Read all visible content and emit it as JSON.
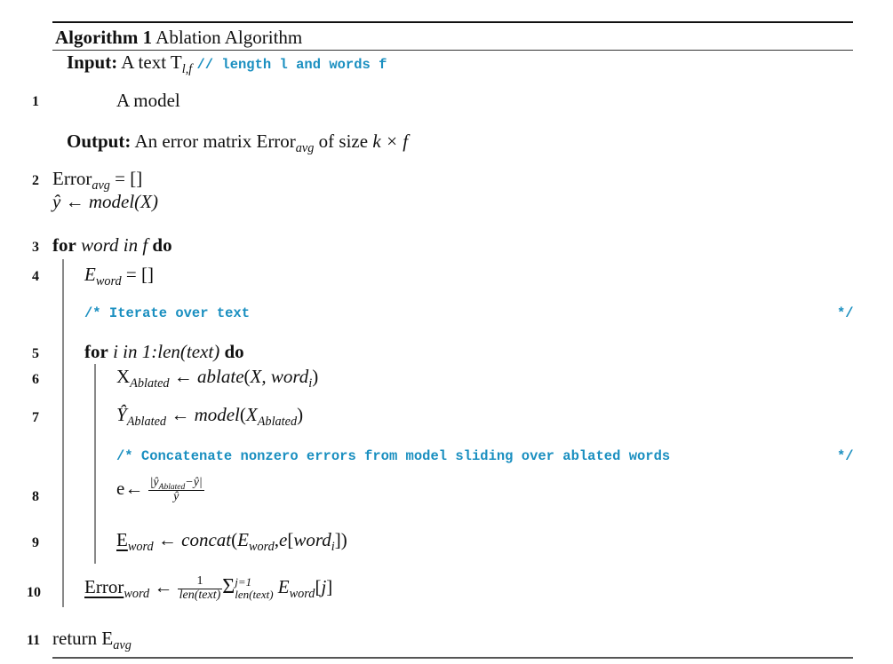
{
  "algorithm": {
    "caption_label": "Algorithm 1",
    "caption_title": "Ablation Algorithm",
    "input": {
      "label": "Input:",
      "text": "A text T",
      "text_sub": "l,f",
      "comment": "// length l and words f",
      "continuation": "A model"
    },
    "output": {
      "label": "Output:",
      "text_pre": "An error matrix Error",
      "text_sub": "avg",
      "text_post": " of size ",
      "size_expr": "k × f"
    },
    "lines": [
      {
        "number": "1",
        "text": "A model"
      },
      {
        "number": "2",
        "text": "Error_avg = []",
        "text2": "ŷ ← model(X)"
      },
      {
        "number": "3",
        "text": "for word in f do"
      },
      {
        "number": "4",
        "text": "E_word = []"
      },
      {
        "comment": "/* Iterate over text",
        "comment_end": "*/"
      },
      {
        "number": "5",
        "text": "for i in 1:len(text) do"
      },
      {
        "number": "6",
        "text": "X_Ablated ← ablate(X, word_i)"
      },
      {
        "number": "7",
        "text": "Ŷ_Ablated ← model(X_Ablated)"
      },
      {
        "comment": "/* Concatenate nonzero errors from model sliding over ablated words",
        "comment_end": "*/"
      },
      {
        "number": "8",
        "text": "e ← |ŷ_Ablated − ŷ| / ŷ"
      },
      {
        "number": "9",
        "text": "E_word ← concat(E_word, e[word_i])"
      },
      {
        "number": "10",
        "text": "Error_word ← 1/len(text) Σ_{len(text)}^{j=1} E_word[j]"
      },
      {
        "number": "11",
        "text": "return E_avg"
      }
    ],
    "tokens": {
      "error": "Error",
      "avg": "avg",
      "empty_list": "[]",
      "eq": " = ",
      "arrow": " ← ",
      "yhat": "ŷ",
      "Yhat": "Ŷ",
      "model_call": "model",
      "X": "X",
      "for": "for",
      "do": "do",
      "word_in_f": "word in f",
      "i_in_range": "i in 1:len(text)",
      "E": "E",
      "word": "word",
      "Ablated": "Ablated",
      "ablate": "ablate",
      "word_i_args": "X, word",
      "i": "i",
      "e": "e",
      "concat": "concat",
      "one": "1",
      "len_text": "len(text)",
      "sigma": "Σ",
      "j_eq_1": "j=1",
      "j": "j",
      "return": "return E"
    }
  }
}
